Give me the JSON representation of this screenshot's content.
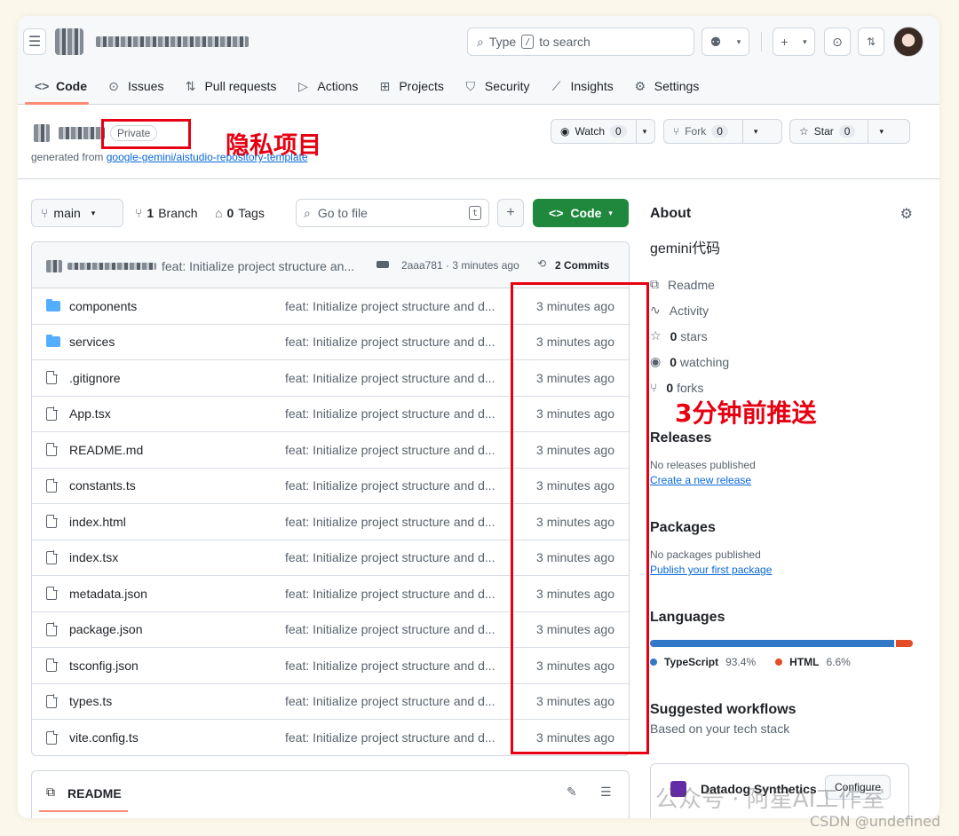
{
  "header": {
    "search_prefix": "Type",
    "search_key": "/",
    "search_suffix": "to search",
    "tabs": [
      {
        "label": "Code",
        "icon": "code-icon",
        "glyph": "<>"
      },
      {
        "label": "Issues",
        "icon": "issue-icon",
        "glyph": "⊙"
      },
      {
        "label": "Pull requests",
        "icon": "pull-request-icon",
        "glyph": "⇅"
      },
      {
        "label": "Actions",
        "icon": "play-icon",
        "glyph": "▷"
      },
      {
        "label": "Projects",
        "icon": "table-icon",
        "glyph": "⊞"
      },
      {
        "label": "Security",
        "icon": "shield-icon",
        "glyph": "⛉"
      },
      {
        "label": "Insights",
        "icon": "graph-icon",
        "glyph": "⟋"
      },
      {
        "label": "Settings",
        "icon": "gear-icon",
        "glyph": "⚙"
      }
    ]
  },
  "repo": {
    "visibility": "Private",
    "generated_prefix": "generated from",
    "template_link": "google-gemini/aistudio-repository-template",
    "watch_label": "Watch",
    "watch_count": "0",
    "fork_label": "Fork",
    "fork_count": "0",
    "star_label": "Star",
    "star_count": "0"
  },
  "annotations": {
    "private_note": "隐私项目",
    "time_note": "3分钟前推送"
  },
  "file_nav": {
    "branch": "main",
    "branch_count": "1",
    "branch_label": "Branch",
    "tag_count": "0",
    "tag_label": "Tags",
    "goto_placeholder": "Go to file",
    "goto_key": "t",
    "add_label": "+",
    "code_label": "Code"
  },
  "commit_bar": {
    "message": "feat: Initialize project structure an...",
    "hash_time": "2aaa781 · 3 minutes ago",
    "commits": "2 Commits"
  },
  "files": [
    {
      "name": "components",
      "type": "dir",
      "message": "feat: Initialize project structure and d...",
      "time": "3 minutes ago"
    },
    {
      "name": "services",
      "type": "dir",
      "message": "feat: Initialize project structure and d...",
      "time": "3 minutes ago"
    },
    {
      "name": ".gitignore",
      "type": "file",
      "message": "feat: Initialize project structure and d...",
      "time": "3 minutes ago"
    },
    {
      "name": "App.tsx",
      "type": "file",
      "message": "feat: Initialize project structure and d...",
      "time": "3 minutes ago"
    },
    {
      "name": "README.md",
      "type": "file",
      "message": "feat: Initialize project structure and d...",
      "time": "3 minutes ago"
    },
    {
      "name": "constants.ts",
      "type": "file",
      "message": "feat: Initialize project structure and d...",
      "time": "3 minutes ago"
    },
    {
      "name": "index.html",
      "type": "file",
      "message": "feat: Initialize project structure and d...",
      "time": "3 minutes ago"
    },
    {
      "name": "index.tsx",
      "type": "file",
      "message": "feat: Initialize project structure and d...",
      "time": "3 minutes ago"
    },
    {
      "name": "metadata.json",
      "type": "file",
      "message": "feat: Initialize project structure and d...",
      "time": "3 minutes ago"
    },
    {
      "name": "package.json",
      "type": "file",
      "message": "feat: Initialize project structure and d...",
      "time": "3 minutes ago"
    },
    {
      "name": "tsconfig.json",
      "type": "file",
      "message": "feat: Initialize project structure and d...",
      "time": "3 minutes ago"
    },
    {
      "name": "types.ts",
      "type": "file",
      "message": "feat: Initialize project structure and d...",
      "time": "3 minutes ago"
    },
    {
      "name": "vite.config.ts",
      "type": "file",
      "message": "feat: Initialize project structure and d...",
      "time": "3 minutes ago"
    }
  ],
  "readme": {
    "label": "README"
  },
  "about": {
    "title": "About",
    "description": "gemini代码",
    "readme": "Readme",
    "activity": "Activity",
    "stars_count": "0",
    "stars_label": "stars",
    "watching_count": "0",
    "watching_label": "watching",
    "forks_count": "0",
    "forks_label": "forks"
  },
  "releases": {
    "title": "Releases",
    "empty": "No releases published",
    "link": "Create a new release"
  },
  "packages": {
    "title": "Packages",
    "empty": "No packages published",
    "link": "Publish your first package"
  },
  "languages": {
    "title": "Languages",
    "items": [
      {
        "name": "TypeScript",
        "percent": "93.4%",
        "value": 93.4,
        "color": "#3178c6"
      },
      {
        "name": "HTML",
        "percent": "6.6%",
        "value": 6.6,
        "color": "#e34c26"
      }
    ]
  },
  "workflows": {
    "title": "Suggested workflows",
    "subtitle": "Based on your tech stack",
    "card_title": "Datadog Synthetics",
    "configure": "Configure"
  },
  "watermark": {
    "wechat": "公众号 · 阿星AI工作室",
    "csdn": "CSDN @undefined"
  }
}
